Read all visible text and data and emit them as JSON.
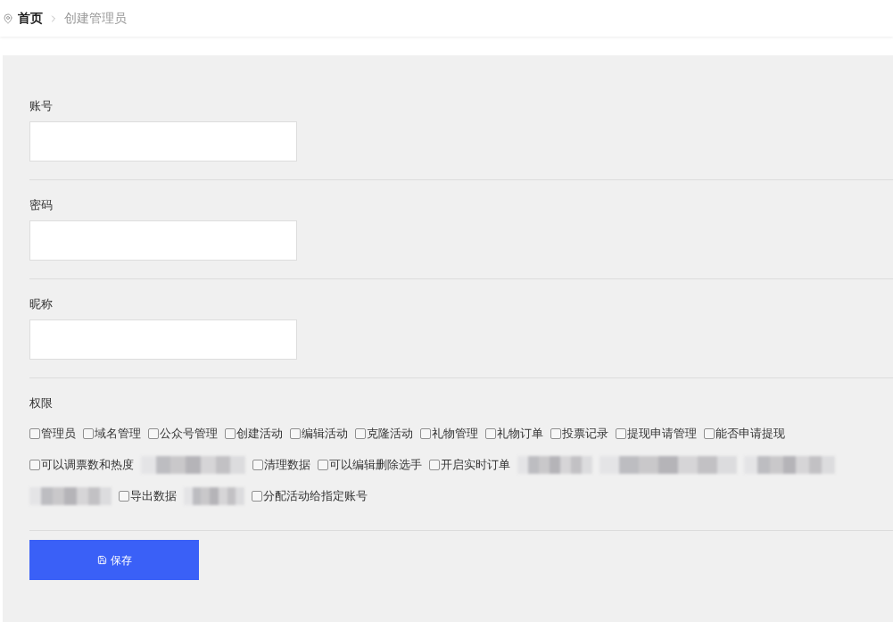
{
  "breadcrumb": [
    {
      "label": "首页",
      "selected": false
    },
    {
      "label": "创建管理员",
      "selected": true
    }
  ],
  "form": {
    "fields": [
      {
        "label": "账号"
      },
      {
        "label": "密码"
      },
      {
        "label": "昵称"
      }
    ],
    "permissions": {
      "label": "权限",
      "options": [
        {
          "kind": "checkbox",
          "label": "管理员",
          "checked": false
        },
        {
          "kind": "checkbox",
          "label": "域名管理",
          "checked": false
        },
        {
          "kind": "checkbox",
          "label": "公众号管理",
          "checked": false
        },
        {
          "kind": "checkbox",
          "label": "创建活动",
          "checked": false
        },
        {
          "kind": "checkbox",
          "label": "编辑活动",
          "checked": false
        },
        {
          "kind": "checkbox",
          "label": "克隆活动",
          "checked": false
        },
        {
          "kind": "checkbox",
          "label": "礼物管理",
          "checked": false
        },
        {
          "kind": "checkbox",
          "label": "礼物订单",
          "checked": false
        },
        {
          "kind": "checkbox",
          "label": "投票记录",
          "checked": false
        },
        {
          "kind": "checkbox",
          "label": "提现申请管理",
          "checked": false
        },
        {
          "kind": "checkbox",
          "label": "能否申请提现",
          "checked": false
        },
        {
          "kind": "checkbox",
          "label": "可以调票数和热度",
          "checked": false
        },
        {
          "kind": "blurred"
        },
        {
          "kind": "checkbox",
          "label": "清理数据",
          "checked": false
        },
        {
          "kind": "checkbox",
          "label": "可以编辑删除选手",
          "checked": false
        },
        {
          "kind": "checkbox",
          "label": "开启实时订单",
          "checked": false
        },
        {
          "kind": "blurred"
        },
        {
          "kind": "blurred"
        },
        {
          "kind": "blurred"
        },
        {
          "kind": "blurred"
        },
        {
          "kind": "checkbox",
          "label": "导出数据",
          "checked": false
        },
        {
          "kind": "blurred"
        },
        {
          "kind": "checkbox",
          "label": "分配活动给指定账号",
          "checked": false
        }
      ]
    },
    "submit": {
      "label": "保存"
    }
  }
}
